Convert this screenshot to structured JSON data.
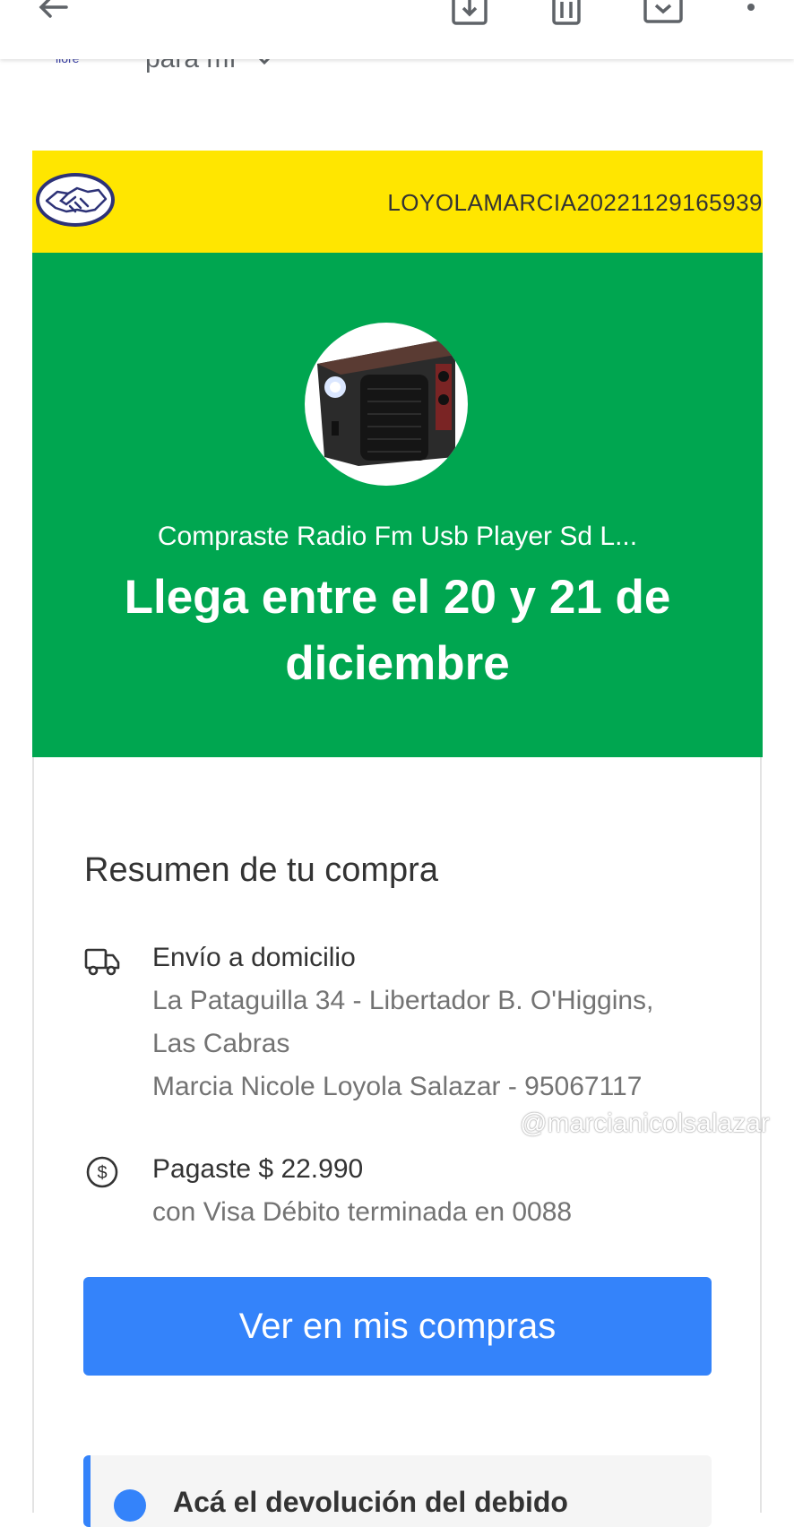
{
  "header": {
    "icons": [
      "arrow-back-icon",
      "archive-download-icon",
      "delete-icon",
      "mail-move-icon",
      "more-vert-icon"
    ]
  },
  "email": {
    "sender_avatar_label": "llore",
    "recipient": "para mí"
  },
  "brand_bar": {
    "color": "#ffe600",
    "order_code": "LOYOLAMARCIA20221129165939"
  },
  "hero": {
    "color": "#00a650",
    "subtitle": "Compraste Radio Fm Usb Player Sd L...",
    "title": "Llega entre el 20 y 21 de diciembre"
  },
  "summary": {
    "title": "Resumen de tu compra",
    "shipping": {
      "title": "Envío a domicilio",
      "lines": [
        "La Pataguilla 34 - Libertador B. O'Higgins,",
        "Las Cabras",
        "Marcia Nicole Loyola Salazar - 95067117"
      ]
    },
    "payment": {
      "title": "Pagaste $ 22.990",
      "detail": "con Visa Débito terminada en 0088"
    },
    "button_label": "Ver en mis compras",
    "button_color": "#3483fa"
  },
  "notice": {
    "text": "Acá el devolución del debido"
  },
  "watermark": {
    "handle": "@marcianicolsalazar"
  }
}
